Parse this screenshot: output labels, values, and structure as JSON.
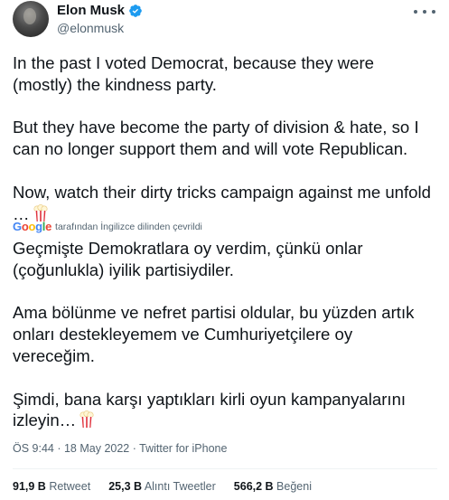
{
  "author": {
    "display_name": "Elon Musk",
    "handle": "@elonmusk",
    "verified_color": "#1d9bf0"
  },
  "more_icon": "more-horizontal-icon",
  "tweet": {
    "lines": [
      "In the past I voted Democrat, because they were (mostly) the kindness party.",
      "But they have become the party of division & hate, so I can no longer support them and will vote Republican.",
      "Now, watch their dirty tricks campaign against me unfold …"
    ],
    "emoji": "popcorn-icon"
  },
  "translation": {
    "provider_logo": "Google",
    "note": "tarafından İngilizce dilinden çevrildi",
    "lines": [
      "Geçmişte Demokratlara oy verdim, çünkü onlar (çoğunlukla) iyilik partisiydiler.",
      " Ama bölünme ve nefret partisi oldular, bu yüzden artık onları destekleyemem ve Cumhuriyetçilere oy vereceğim.",
      " Şimdi, bana karşı yaptıkları kirli oyun kampanyalarını izleyin…"
    ]
  },
  "meta": {
    "time": "ÖS 9:44",
    "separator1": " · ",
    "date": "18 May 2022",
    "separator2": " · ",
    "source": "Twitter for iPhone"
  },
  "stats": {
    "retweets_count": "91,9 B",
    "retweets_label": " Retweet",
    "quotes_count": "25,3 B",
    "quotes_label": " Alıntı Tweetler",
    "likes_count": "566,2 B",
    "likes_label": " Beğeni"
  }
}
